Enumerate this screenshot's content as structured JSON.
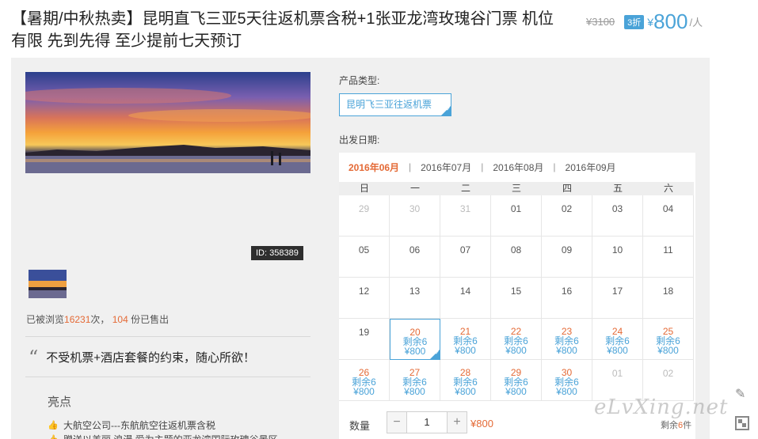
{
  "product": {
    "title": "【暑期/中秋热卖】昆明直飞三亚5天往返机票含税+1张亚龙湾玫瑰谷门票 机位有限 先到先得 至少提前七天预订",
    "old_price": "¥3100",
    "discount": "3折",
    "currency": "¥",
    "price": "800",
    "unit": "/人"
  },
  "gallery": {
    "id_tag": "ID: 358389"
  },
  "stats": {
    "prefix": "已被浏览",
    "views": "16231",
    "mid": "次，",
    "sold": "104",
    "suffix": "份已售出"
  },
  "quote": {
    "mark": "“",
    "text": "不受机票+酒店套餐的约束，随心所欲！"
  },
  "highlights": {
    "title": "亮点",
    "items": [
      "大航空公司---东航航空往返机票含税",
      "赠送以美丽,浪漫,爱为主题的亚龙湾国际玫瑰谷景区"
    ]
  },
  "booking": {
    "product_type_label": "产品类型:",
    "product_type_value": "昆明飞三亚往返机票",
    "date_label": "出发日期:",
    "months": [
      "2016年06月",
      "2016年07月",
      "2016年08月",
      "2016年09月"
    ],
    "separator": "|",
    "weekdays": [
      "日",
      "一",
      "二",
      "三",
      "四",
      "五",
      "六"
    ],
    "rows": [
      [
        {
          "d": "29",
          "m": 1
        },
        {
          "d": "30",
          "m": 1
        },
        {
          "d": "31",
          "m": 1
        },
        {
          "d": "01"
        },
        {
          "d": "02"
        },
        {
          "d": "03"
        },
        {
          "d": "04"
        }
      ],
      [
        {
          "d": "05"
        },
        {
          "d": "06"
        },
        {
          "d": "07"
        },
        {
          "d": "08"
        },
        {
          "d": "09"
        },
        {
          "d": "10"
        },
        {
          "d": "11"
        }
      ],
      [
        {
          "d": "12"
        },
        {
          "d": "13"
        },
        {
          "d": "14"
        },
        {
          "d": "15"
        },
        {
          "d": "16"
        },
        {
          "d": "17"
        },
        {
          "d": "18"
        }
      ],
      [
        {
          "d": "19"
        },
        {
          "d": "20",
          "a": 1,
          "sel": 1
        },
        {
          "d": "21",
          "a": 1
        },
        {
          "d": "22",
          "a": 1
        },
        {
          "d": "23",
          "a": 1
        },
        {
          "d": "24",
          "a": 1
        },
        {
          "d": "25",
          "a": 1
        }
      ],
      [
        {
          "d": "26",
          "a": 1
        },
        {
          "d": "27",
          "a": 1
        },
        {
          "d": "28",
          "a": 1
        },
        {
          "d": "29",
          "a": 1
        },
        {
          "d": "30",
          "a": 1
        },
        {
          "d": "01",
          "m": 1
        },
        {
          "d": "02",
          "m": 1
        }
      ]
    ],
    "stock_text": "剩余6",
    "cell_price": "¥800",
    "qty_label": "数量",
    "minus": "−",
    "qty_value": "1",
    "plus": "+",
    "total": "¥800",
    "remain_prefix": "剩余",
    "remain_num": "6",
    "remain_suffix": "件"
  },
  "watermark": "eLvXing.net",
  "colors": {
    "accent": "#4aa3d8",
    "highlight": "#e46a36"
  }
}
